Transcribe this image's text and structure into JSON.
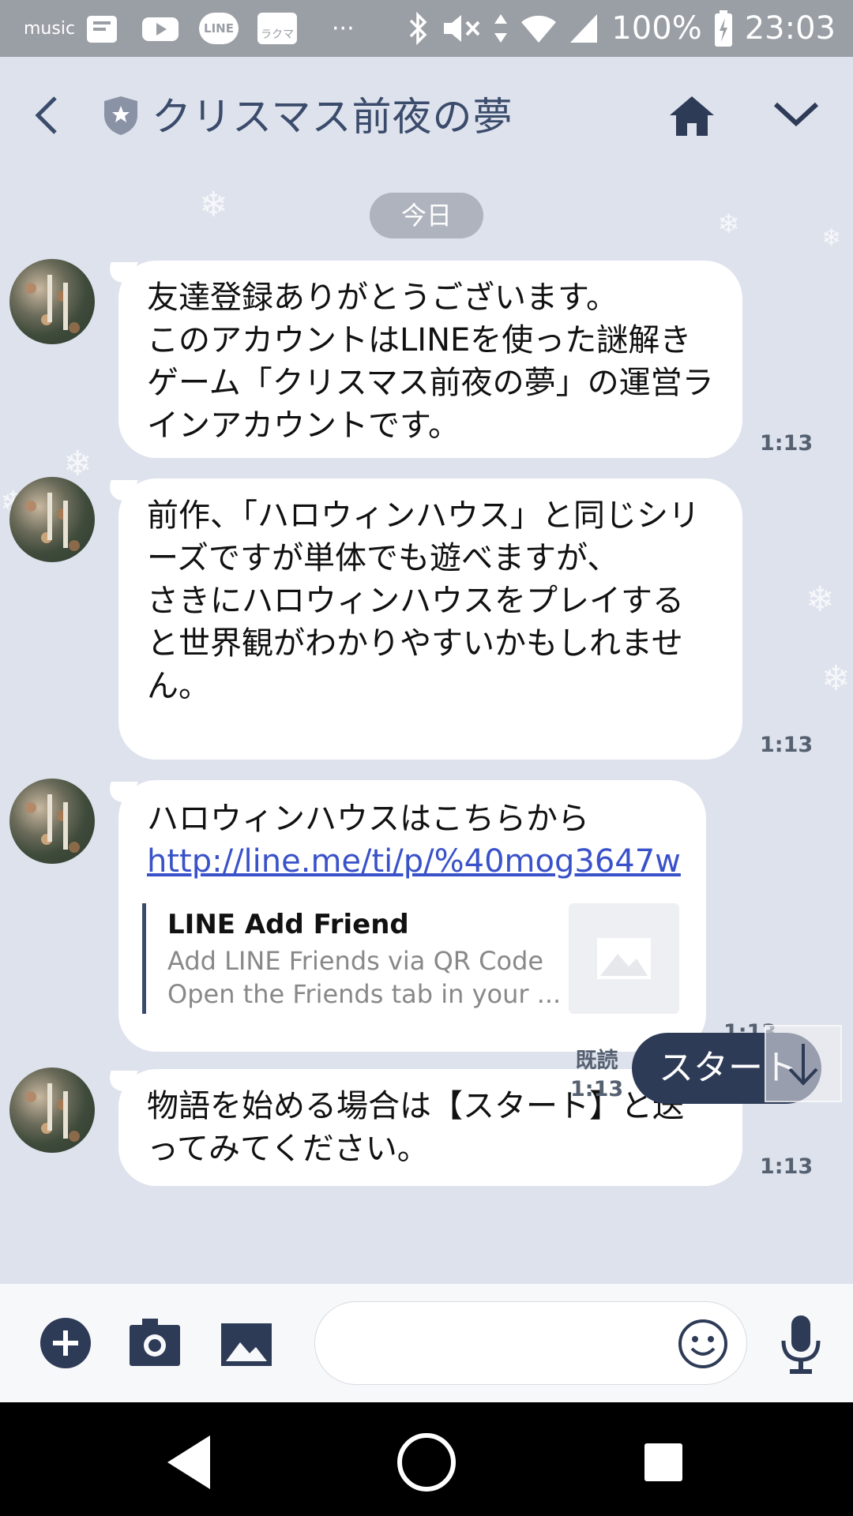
{
  "status_bar": {
    "left_icons": [
      "music-app-icon",
      "mail-icon",
      "youtube-icon",
      "line-icon",
      "rakuma-icon",
      "more-dots-icon"
    ],
    "music_label": "music",
    "line_label": "LINE",
    "rakuma_label": "ラクマ",
    "more_dots": "···",
    "battery": "100%",
    "time": "23:03"
  },
  "header": {
    "title": "クリスマス前夜の夢"
  },
  "chat": {
    "date_label": "今日",
    "messages": [
      {
        "text": "友達登録ありがとうございます。\nこのアカウントはLINEを使った謎解きゲーム「クリスマス前夜の夢」の運営ラインアカウントです。",
        "time": "1:13"
      },
      {
        "text": "前作、「ハロウィンハウス」と同じシリーズですが単体でも遊べますが、\nさきにハロウィンハウスをプレイすると世界観がわかりやすいかもしれません。",
        "time": "1:13"
      },
      {
        "text": "ハロウィンハウスはこちらから",
        "link": "http://line.me/ti/p/%40mog3647w",
        "preview_title": "LINE Add Friend",
        "preview_desc": "Add LINE Friends via QR Code\nOpen the Friends tab in your ...",
        "time": "1:13"
      },
      {
        "text": "物語を始める場合は【スタート】と送ってみてください。",
        "time": "1:13"
      }
    ],
    "sent": {
      "text": "スタート",
      "read_label": "既読",
      "time": "1:13"
    }
  },
  "colors": {
    "accent": "#2e3b57",
    "link": "#3a52c9",
    "background": "#dde2ec"
  }
}
